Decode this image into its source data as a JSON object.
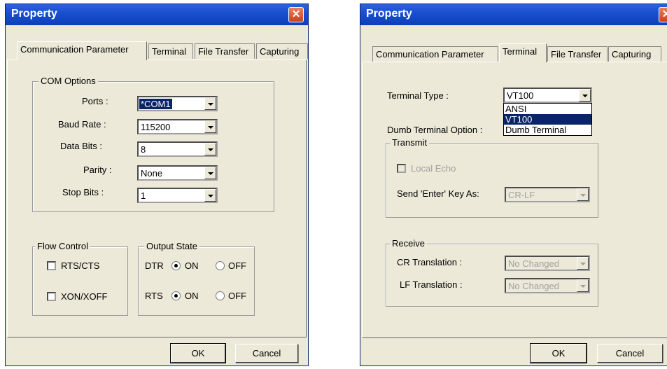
{
  "left": {
    "title": "Property",
    "close_glyph": "✕",
    "tabs": [
      "Communication Parameter",
      "Terminal",
      "File Transfer",
      "Capturing"
    ],
    "active_tab": "Communication Parameter",
    "com_options": {
      "title": "COM Options",
      "ports_label": "Ports :",
      "ports_value": "*COM1",
      "baud_label": "Baud Rate :",
      "baud_value": "115200",
      "data_bits_label": "Data Bits :",
      "data_bits_value": "8",
      "parity_label": "Parity :",
      "parity_value": "None",
      "stop_bits_label": "Stop Bits :",
      "stop_bits_value": "1"
    },
    "flow_control": {
      "title": "Flow Control",
      "rts_cts": "RTS/CTS",
      "rts_cts_checked": false,
      "xon_xoff": "XON/XOFF",
      "xon_xoff_checked": false
    },
    "output_state": {
      "title": "Output State",
      "dtr_label": "DTR",
      "rts_label": "RTS",
      "on_label": "ON",
      "off_label": "OFF",
      "dtr_selected": "ON",
      "rts_selected": "ON"
    },
    "ok_label": "OK",
    "cancel_label": "Cancel"
  },
  "right": {
    "title": "Property",
    "close_glyph": "✕",
    "tabs": [
      "Communication Parameter",
      "Terminal",
      "File Transfer",
      "Capturing"
    ],
    "active_tab": "Terminal",
    "terminal_type_label": "Terminal Type :",
    "terminal_type_value": "VT100",
    "terminal_type_options": [
      "ANSI",
      "VT100",
      "Dumb Terminal"
    ],
    "terminal_type_highlighted": "VT100",
    "dumb_terminal_option_label": "Dumb Terminal Option :",
    "transmit": {
      "title": "Transmit",
      "local_echo": "Local Echo",
      "send_enter_label": "Send 'Enter' Key  As:",
      "send_enter_value": "CR-LF"
    },
    "receive": {
      "title": "Receive",
      "cr_label": "CR Translation :",
      "cr_value": "No Changed",
      "lf_label": "LF Translation :",
      "lf_value": "No Changed"
    },
    "ok_label": "OK",
    "cancel_label": "Cancel"
  }
}
